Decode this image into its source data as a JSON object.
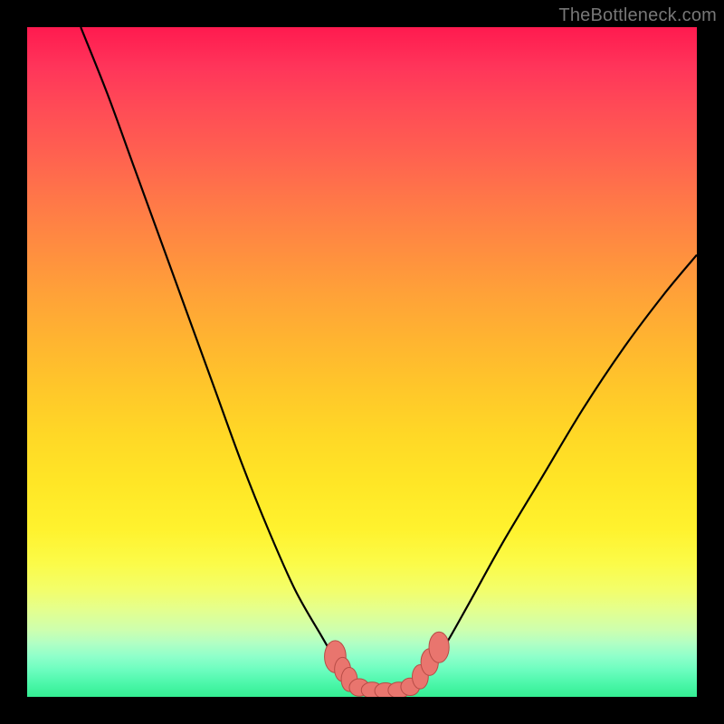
{
  "watermark": "TheBottleneck.com",
  "colors": {
    "frame": "#000000",
    "curve": "#000000",
    "marker_fill": "#e9756e",
    "marker_stroke": "#b74c46",
    "gradient_top": "#ff1a4f",
    "gradient_bottom": "#34ee93"
  },
  "chart_data": {
    "type": "line",
    "title": "",
    "xlabel": "",
    "ylabel": "",
    "xlim": [
      0,
      100
    ],
    "ylim": [
      0,
      100
    ],
    "grid": false,
    "legend": "none",
    "series": [
      {
        "name": "left-curve",
        "x": [
          8,
          12,
          16,
          20,
          24,
          28,
          32,
          36,
          40,
          44,
          47,
          49
        ],
        "y": [
          100,
          90,
          79,
          68,
          57,
          46,
          35,
          25,
          16,
          9,
          4,
          2
        ]
      },
      {
        "name": "right-curve",
        "x": [
          57,
          59,
          62,
          66,
          71,
          77,
          83,
          89,
          95,
          100
        ],
        "y": [
          1,
          3,
          7,
          14,
          23,
          33,
          43,
          52,
          60,
          66
        ]
      },
      {
        "name": "valley-floor",
        "x": [
          49,
          51,
          53,
          55,
          57
        ],
        "y": [
          2,
          1,
          1,
          1,
          1
        ]
      }
    ],
    "markers": [
      {
        "name": "left-upper-1",
        "cx": 46.0,
        "cy": 6.0,
        "rx": 1.6,
        "ry": 2.4
      },
      {
        "name": "left-upper-2",
        "cx": 47.1,
        "cy": 4.1,
        "rx": 1.2,
        "ry": 1.8
      },
      {
        "name": "left-lower",
        "cx": 48.1,
        "cy": 2.6,
        "rx": 1.2,
        "ry": 1.8
      },
      {
        "name": "floor-1",
        "cx": 49.6,
        "cy": 1.4,
        "rx": 1.5,
        "ry": 1.3
      },
      {
        "name": "floor-2",
        "cx": 51.5,
        "cy": 1.0,
        "rx": 1.6,
        "ry": 1.2
      },
      {
        "name": "floor-3",
        "cx": 53.5,
        "cy": 0.9,
        "rx": 1.6,
        "ry": 1.2
      },
      {
        "name": "floor-4",
        "cx": 55.5,
        "cy": 1.0,
        "rx": 1.6,
        "ry": 1.2
      },
      {
        "name": "floor-5",
        "cx": 57.2,
        "cy": 1.5,
        "rx": 1.4,
        "ry": 1.3
      },
      {
        "name": "right-lower",
        "cx": 58.7,
        "cy": 3.0,
        "rx": 1.2,
        "ry": 1.8
      },
      {
        "name": "right-upper-1",
        "cx": 60.1,
        "cy": 5.2,
        "rx": 1.3,
        "ry": 2.0
      },
      {
        "name": "right-upper-2",
        "cx": 61.5,
        "cy": 7.4,
        "rx": 1.5,
        "ry": 2.3
      }
    ]
  }
}
